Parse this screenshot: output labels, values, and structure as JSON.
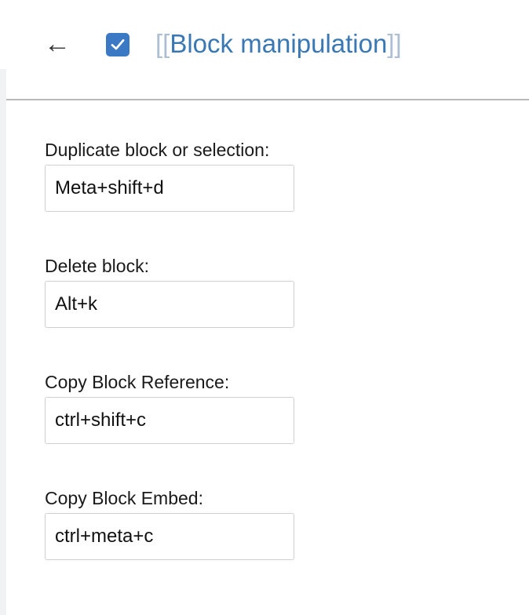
{
  "header": {
    "back_icon": "arrow-left-icon",
    "checkbox_checked": true,
    "title_open": "[[",
    "title": "Block manipulation",
    "title_close": "]]",
    "accent_color": "#3b79c5"
  },
  "fields": [
    {
      "label": "Duplicate block or selection:",
      "value": "Meta+shift+d"
    },
    {
      "label": "Delete block:",
      "value": "Alt+k"
    },
    {
      "label": "Copy Block Reference:",
      "value": "ctrl+shift+c"
    },
    {
      "label": "Copy Block Embed:",
      "value": "ctrl+meta+c"
    }
  ]
}
